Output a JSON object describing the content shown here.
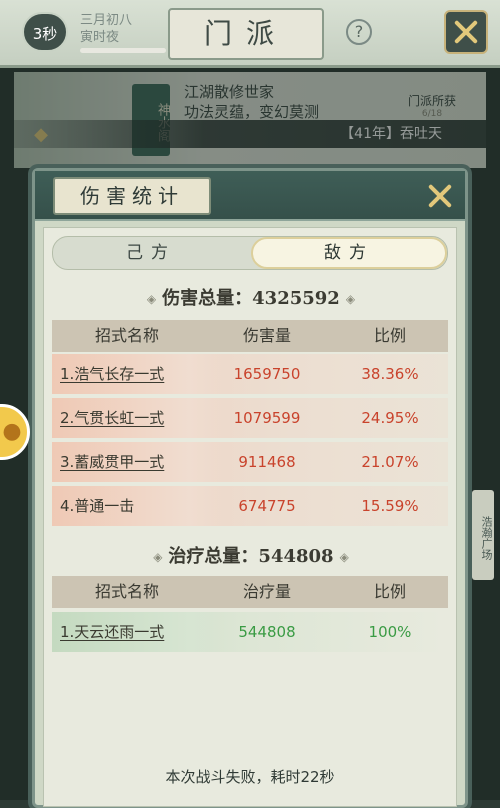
{
  "topbar": {
    "timer": "3秒",
    "date_line1": "三月初八",
    "date_line2": "寅时夜",
    "title": "门派",
    "help": "?"
  },
  "sect": {
    "name": "神水阁",
    "desc_line1": "江湖散修世家",
    "desc_line2": "功法灵蕴，变幻莫测",
    "loot_label": "门派所获",
    "loot_count": "6/18"
  },
  "ticker": {
    "text": "【41年】吞吐天"
  },
  "dialog": {
    "title": "伤害统计",
    "tabs": [
      "己方",
      "敌方"
    ],
    "active_tab": "敌方",
    "damage": {
      "label": "伤害总量：4325592",
      "columns": [
        "招式名称",
        "伤害量",
        "比例"
      ],
      "rows": [
        {
          "skill": "1.浩气长存一式",
          "value": "1659750",
          "pct": "38.36%",
          "underlined": true
        },
        {
          "skill": "2.气贯长虹一式",
          "value": "1079599",
          "pct": "24.95%",
          "underlined": true
        },
        {
          "skill": "3.蓄威贯甲一式",
          "value": "911468",
          "pct": "21.07%",
          "underlined": true
        },
        {
          "skill": "4.普通一击",
          "value": "674775",
          "pct": "15.59%",
          "underlined": false
        }
      ]
    },
    "heal": {
      "label": "治疗总量：544808",
      "columns": [
        "招式名称",
        "治疗量",
        "比例"
      ],
      "rows": [
        {
          "skill": "1.天云还雨一式",
          "value": "544808",
          "pct": "100%",
          "underlined": true
        }
      ]
    },
    "footer": "本次战斗失败，耗时22秒"
  },
  "side_tab": "浩瀚广场",
  "colors": {
    "damage": "#c9432c",
    "heal": "#3a9b44",
    "header": "#3f5e57",
    "accent_gold": "#e2c87b"
  }
}
